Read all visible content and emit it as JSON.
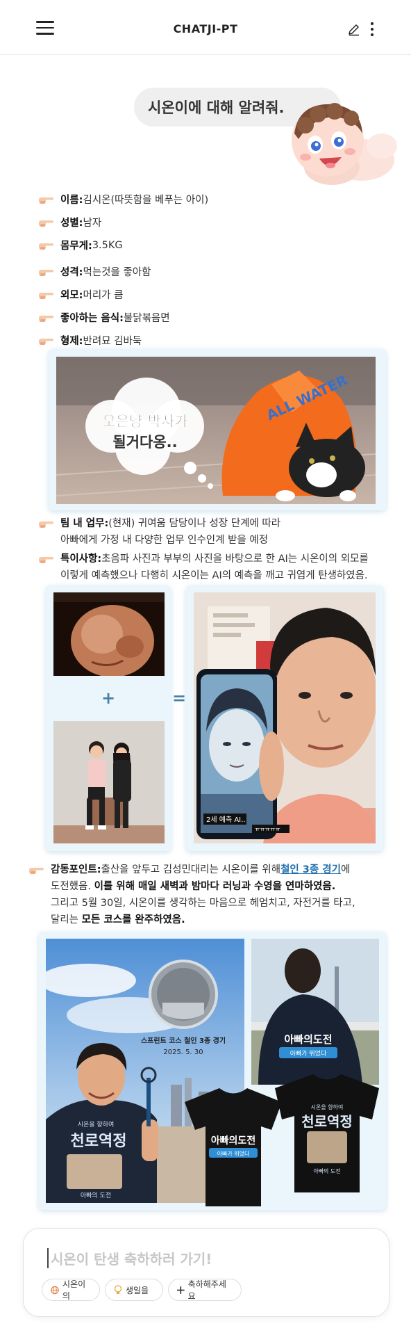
{
  "header": {
    "title": "CHATJI-PT"
  },
  "chat": {
    "question": "시온이에 대해 알려줘."
  },
  "info": [
    {
      "label": "이름:",
      "value": " 김시온(따뜻함을 베푸는 아이)"
    },
    {
      "label": "성별:",
      "value": " 남자"
    },
    {
      "label": "몸무게:",
      "value": " 3.5KG"
    },
    {
      "label": "성격:",
      "value": " 먹는것을 좋아함"
    },
    {
      "label": "외모:",
      "value": " 머리가 큼"
    },
    {
      "label": "좋아하는 음식:",
      "value": " 불닭볶음면"
    },
    {
      "label": "형제:",
      "value": " 반려묘 김바둑"
    }
  ],
  "cat_photo": {
    "cloud_text_1": "오은냥 박사가",
    "cloud_text_2": "될거다옹..",
    "shirt_text": "ALL WATER"
  },
  "team": {
    "label": "팀 내 업무:",
    "line1": " (현재) 귀여움 담당이나 성장 단계에 따라",
    "line2": "아빠에게 가정 내 다양한 업무 인수인계 받을 예정"
  },
  "special": {
    "label": "특이사항:",
    "line1": " 초음파 사진과 부부의 사진을 바탕으로 한 AI는 시온이의 외모를",
    "line2": "이렇게 예측했으나 다행히 시온이는 AI의 예측을 깨고 귀엽게 탄생하였음."
  },
  "ai_section": {
    "plus": "+",
    "equals": "=",
    "phone_caption": "2세 예측 AI..",
    "phone_caption2": "ㅠㅠㅠㅠㅠ"
  },
  "moving": {
    "label": "감동포인트:",
    "line1a": " 출산을 앞두고 김성민대리는 시온이를 위해 ",
    "link": "철인 3종 경기",
    "line1b": "에",
    "line2a": "도전했음. ",
    "line2b": "이를 위해 매일 새벽과 밤마다 러닝과 수영을 연마하였음.",
    "line3": "그리고 5월 30일, 시온이를 생각하는 마음으로 헤엄치고, 자전거를 타고,",
    "line4a": "달리는 ",
    "line4b": "모든 코스를 완주하였음."
  },
  "triathlon": {
    "race": "스프린트 코스 철인 3종 경기",
    "date": "2025. 5. 30",
    "shirt_small": "시온을 향하여",
    "shirt_big": "천로역정",
    "shirt_sub": "아빠의 도전",
    "back_title": "아빠의도전",
    "back_sub": "아빠가 뛰었다"
  },
  "composer": {
    "placeholder": "시온이 탄생 축하하러 가기!",
    "chips": [
      "시온이의",
      "생일을",
      "축하해주세요"
    ]
  }
}
